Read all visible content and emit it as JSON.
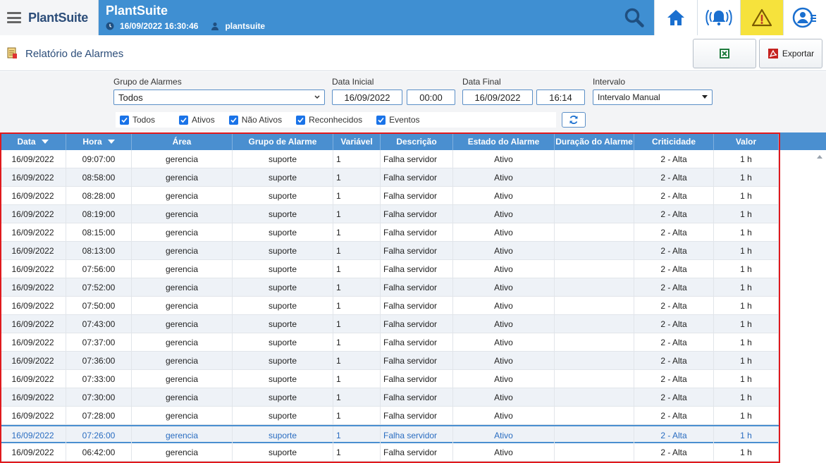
{
  "brand": {
    "name": "PlantSuite"
  },
  "header": {
    "title": "PlantSuite",
    "datetime": "16/09/2022 16:30:46",
    "user": "plantsuite"
  },
  "report": {
    "title": "Relatório de Alarmes",
    "export_label": "Exportar"
  },
  "filters": {
    "group_label": "Grupo de Alarmes",
    "group_value": "Todos",
    "start_label": "Data Inicial",
    "start_date": "16/09/2022",
    "start_time": "00:00",
    "end_label": "Data Final",
    "end_date": "16/09/2022",
    "end_time": "16:14",
    "interval_label": "Intervalo",
    "interval_value": "Intervalo Manual",
    "checks": [
      {
        "label": "Todos",
        "checked": true
      },
      {
        "label": "Ativos",
        "checked": true
      },
      {
        "label": "Não Ativos",
        "checked": true
      },
      {
        "label": "Reconhecidos",
        "checked": true
      },
      {
        "label": "Eventos",
        "checked": true
      }
    ]
  },
  "table": {
    "columns": [
      "Data",
      "Hora",
      "Área",
      "Grupo de Alarme",
      "Variável",
      "Descrição",
      "Estado do Alarme",
      "Duração do Alarme",
      "Criticidade",
      "Valor"
    ],
    "rows": [
      [
        "16/09/2022",
        "09:07:00",
        "gerencia",
        "suporte",
        "1",
        "Falha servidor",
        "Ativo",
        "",
        "2 - Alta",
        "1 h"
      ],
      [
        "16/09/2022",
        "08:58:00",
        "gerencia",
        "suporte",
        "1",
        "Falha servidor",
        "Ativo",
        "",
        "2 - Alta",
        "1 h"
      ],
      [
        "16/09/2022",
        "08:28:00",
        "gerencia",
        "suporte",
        "1",
        "Falha servidor",
        "Ativo",
        "",
        "2 - Alta",
        "1 h"
      ],
      [
        "16/09/2022",
        "08:19:00",
        "gerencia",
        "suporte",
        "1",
        "Falha servidor",
        "Ativo",
        "",
        "2 - Alta",
        "1 h"
      ],
      [
        "16/09/2022",
        "08:15:00",
        "gerencia",
        "suporte",
        "1",
        "Falha servidor",
        "Ativo",
        "",
        "2 - Alta",
        "1 h"
      ],
      [
        "16/09/2022",
        "08:13:00",
        "gerencia",
        "suporte",
        "1",
        "Falha servidor",
        "Ativo",
        "",
        "2 - Alta",
        "1 h"
      ],
      [
        "16/09/2022",
        "07:56:00",
        "gerencia",
        "suporte",
        "1",
        "Falha servidor",
        "Ativo",
        "",
        "2 - Alta",
        "1 h"
      ],
      [
        "16/09/2022",
        "07:52:00",
        "gerencia",
        "suporte",
        "1",
        "Falha servidor",
        "Ativo",
        "",
        "2 - Alta",
        "1 h"
      ],
      [
        "16/09/2022",
        "07:50:00",
        "gerencia",
        "suporte",
        "1",
        "Falha servidor",
        "Ativo",
        "",
        "2 - Alta",
        "1 h"
      ],
      [
        "16/09/2022",
        "07:43:00",
        "gerencia",
        "suporte",
        "1",
        "Falha servidor",
        "Ativo",
        "",
        "2 - Alta",
        "1 h"
      ],
      [
        "16/09/2022",
        "07:37:00",
        "gerencia",
        "suporte",
        "1",
        "Falha servidor",
        "Ativo",
        "",
        "2 - Alta",
        "1 h"
      ],
      [
        "16/09/2022",
        "07:36:00",
        "gerencia",
        "suporte",
        "1",
        "Falha servidor",
        "Ativo",
        "",
        "2 - Alta",
        "1 h"
      ],
      [
        "16/09/2022",
        "07:33:00",
        "gerencia",
        "suporte",
        "1",
        "Falha servidor",
        "Ativo",
        "",
        "2 - Alta",
        "1 h"
      ],
      [
        "16/09/2022",
        "07:30:00",
        "gerencia",
        "suporte",
        "1",
        "Falha servidor",
        "Ativo",
        "",
        "2 - Alta",
        "1 h"
      ],
      [
        "16/09/2022",
        "07:28:00",
        "gerencia",
        "suporte",
        "1",
        "Falha servidor",
        "Ativo",
        "",
        "2 - Alta",
        "1 h"
      ],
      [
        "16/09/2022",
        "07:26:00",
        "gerencia",
        "suporte",
        "1",
        "Falha servidor",
        "Ativo",
        "",
        "2 - Alta",
        "1 h"
      ],
      [
        "16/09/2022",
        "06:42:00",
        "gerencia",
        "suporte",
        "1",
        "Falha servidor",
        "Ativo",
        "",
        "2 - Alta",
        "1 h"
      ]
    ],
    "selected_row": 15
  },
  "colors": {
    "accent": "#3f8fd2",
    "header": "#4a8fd0",
    "warning": "#f6e23c",
    "highlight_border": "#e0191d"
  },
  "icons": [
    "menu-icon",
    "clock-icon",
    "user-icon",
    "search-icon",
    "home-icon",
    "alarm-bell-icon",
    "warning-icon",
    "user-profile-icon",
    "report-icon",
    "excel-icon",
    "pdf-icon",
    "refresh-icon"
  ]
}
